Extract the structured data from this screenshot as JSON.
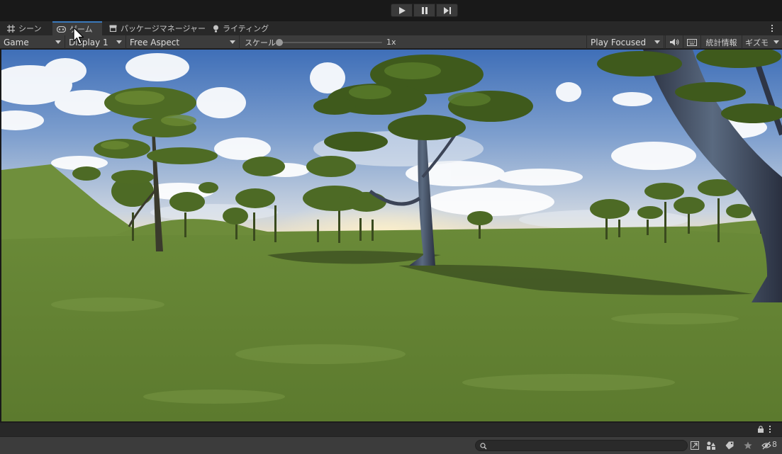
{
  "playbar": {
    "buttons": [
      {
        "name": "play",
        "icon": "play-icon"
      },
      {
        "name": "pause",
        "icon": "pause-icon"
      },
      {
        "name": "step",
        "icon": "step-icon"
      }
    ]
  },
  "tabs": [
    {
      "label": "シーン",
      "icon": "grid-icon",
      "active": false
    },
    {
      "label": "ゲーム",
      "icon": "gamepad-icon",
      "active": true
    },
    {
      "label": "パッケージマネージャー",
      "icon": "package-icon",
      "active": false
    },
    {
      "label": "ライティング",
      "icon": "lightbulb-icon",
      "active": false
    }
  ],
  "game_toolbar": {
    "view_mode": "Game",
    "display": "Display 1",
    "aspect": "Free Aspect",
    "scale_label": "スケール",
    "scale_value": "1x",
    "play_mode": "Play Focused",
    "stats_label": "統計情報",
    "gizmos_label": "ギズモ"
  },
  "project_bar": {
    "hidden_count": "8"
  },
  "colors": {
    "accent": "#3a79bb",
    "panel": "#3c3c3c",
    "tab_strip": "#282828",
    "background": "#191919"
  }
}
